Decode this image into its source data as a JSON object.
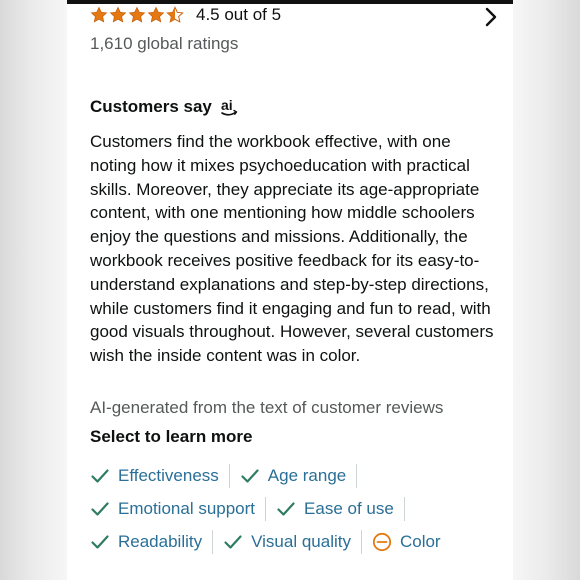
{
  "colors": {
    "star": "#e47911",
    "link": "#2a6f97",
    "check": "#2e7d61",
    "negative": "#e47911",
    "muted": "#565959",
    "text": "#0f1111"
  },
  "rating": {
    "value": 4.5,
    "text": "4.5 out of 5",
    "count_text": "1,610 global ratings"
  },
  "customers_say": {
    "title": "Customers say",
    "badge_icon": "ai-icon",
    "summary": "Customers find the workbook effective, with one noting how it mixes psychoeducation with practical skills. Moreover, they appreciate its age-appropriate content, with one mentioning how middle schoolers enjoy the questions and missions. Additionally, the workbook receives positive feedback for its easy-to-understand explanations and step-by-step directions, while customers find it engaging and fun to read, with good visuals throughout. However, several customers wish the inside content was in color.",
    "ai_note": "AI-generated from the text of customer reviews"
  },
  "learn_more": {
    "title": "Select to learn more",
    "rows": [
      [
        {
          "label": "Effectiveness",
          "sentiment": "positive"
        },
        {
          "label": "Age range",
          "sentiment": "positive"
        }
      ],
      [
        {
          "label": "Emotional support",
          "sentiment": "positive"
        },
        {
          "label": "Ease of use",
          "sentiment": "positive"
        }
      ],
      [
        {
          "label": "Readability",
          "sentiment": "positive"
        },
        {
          "label": "Visual quality",
          "sentiment": "positive"
        },
        {
          "label": "Color",
          "sentiment": "negative"
        }
      ]
    ]
  }
}
